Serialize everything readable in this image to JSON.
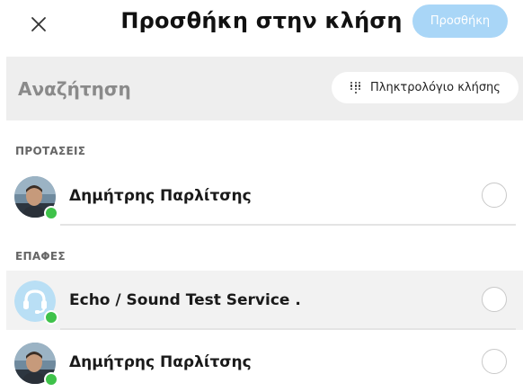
{
  "header": {
    "title": "Προσθήκη στην κλήση",
    "add_button_label": "Προσθήκη",
    "close_icon": "close-icon"
  },
  "search": {
    "placeholder": "Αναζήτηση",
    "dialpad_label": "Πληκτρολόγιο κλήσης",
    "dialpad_icon": "dialpad-icon"
  },
  "sections": [
    {
      "title": "ΠΡΟΤΑΣΕΙΣ",
      "contacts": [
        {
          "name": "Δημήτρης Παρλίτσης",
          "avatar": "photo",
          "presence": "online",
          "selected": false
        }
      ]
    },
    {
      "title": "ΕΠΑΦΕΣ",
      "contacts": [
        {
          "name": "Echo / Sound Test Service .",
          "avatar": "headset-bot",
          "presence": "online",
          "selected": false
        },
        {
          "name": "Δημήτρης Παρλίτσης",
          "avatar": "photo",
          "presence": "online",
          "selected": false
        }
      ]
    }
  ],
  "colors": {
    "accent_disabled": "#a9d6f7",
    "presence_online": "#3fc24a",
    "search_bg": "#eeeeee",
    "bot_avatar_bg": "#b9dff5"
  }
}
